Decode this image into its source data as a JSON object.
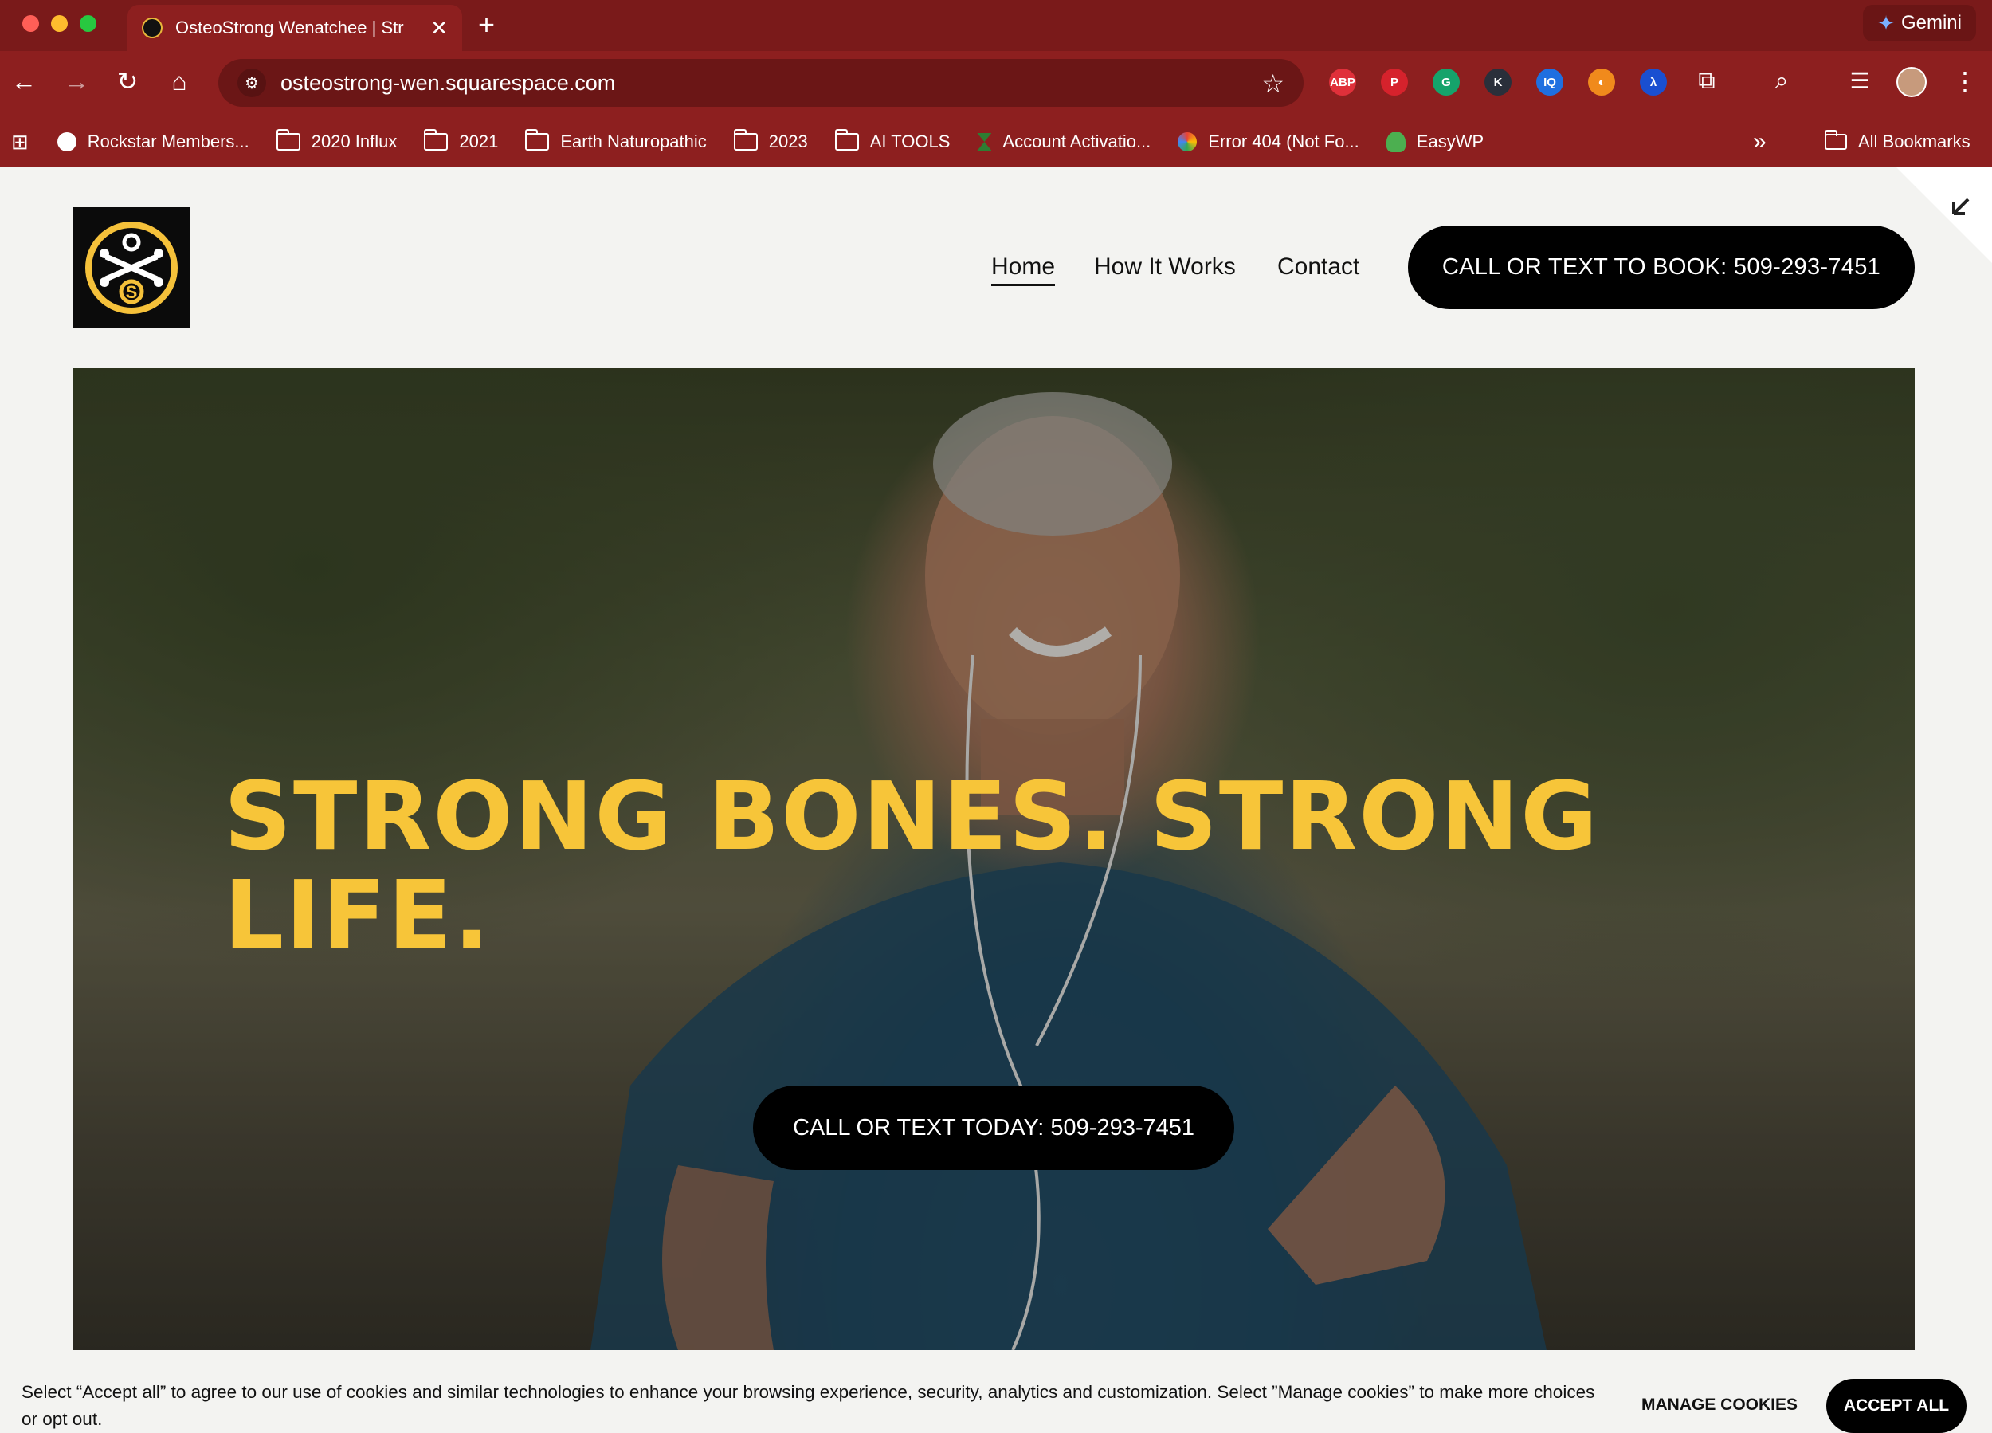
{
  "browser": {
    "tab_title": "OsteoStrong Wenatchee | Str",
    "tab_close": "✕",
    "new_tab": "+",
    "gemini_label": "Gemini",
    "url": "osteostrong-wen.squarespace.com",
    "nav_icons": [
      "back-icon",
      "forward-icon",
      "reload-icon",
      "home-icon"
    ],
    "extensions": [
      {
        "name": "adblock-plus-icon",
        "label": "ABP",
        "color": "#e0303a"
      },
      {
        "name": "pinterest-icon",
        "label": "P",
        "color": "#d6222c"
      },
      {
        "name": "grammarly-icon",
        "label": "G",
        "color": "#15a36b"
      },
      {
        "name": "k-extension-icon",
        "label": "K",
        "color": "#2a2f3a"
      },
      {
        "name": "iq-extension-icon",
        "label": "IQ",
        "color": "#1f6fe0"
      },
      {
        "name": "orange-extension-icon",
        "label": "◐",
        "color": "#f08a1c"
      },
      {
        "name": "lambda-extension-icon",
        "label": "λ",
        "color": "#1a4fd1"
      }
    ]
  },
  "bookmarks": {
    "items": [
      {
        "label": "Rockstar Members...",
        "icon": "globe-icon"
      },
      {
        "label": "2020 Influx",
        "icon": "folder-icon"
      },
      {
        "label": "2021",
        "icon": "folder-icon"
      },
      {
        "label": "Earth Naturopathic",
        "icon": "folder-icon"
      },
      {
        "label": "2023",
        "icon": "folder-icon"
      },
      {
        "label": "AI TOOLS",
        "icon": "folder-icon"
      },
      {
        "label": "Account Activatio...",
        "icon": "hourglass-icon"
      },
      {
        "label": "Error 404 (Not Fo...",
        "icon": "pinwheel-icon"
      },
      {
        "label": "EasyWP",
        "icon": "octopus-icon"
      }
    ],
    "overflow": "»",
    "all_bookmarks": "All Bookmarks"
  },
  "site": {
    "nav": [
      {
        "label": "Home",
        "active": true
      },
      {
        "label": "How It Works",
        "active": false
      },
      {
        "label": "Contact",
        "active": false
      }
    ],
    "header_cta": "CALL OR TEXT TO BOOK: 509-293-7451",
    "logo_letter": "S"
  },
  "hero": {
    "title_line1": "STRONG BONES. STRONG",
    "title_line2": "LIFE.",
    "cta": "CALL OR TEXT TODAY: 509-293-7451"
  },
  "cookie_banner": {
    "text": "Select “Accept all” to agree to our use of cookies and similar technologies to enhance your browsing experience, security, analytics and customization. Select ”Manage cookies” to make more choices or opt out.",
    "manage_label": "MANAGE COOKIES",
    "accept_label": "ACCEPT ALL"
  },
  "colors": {
    "browser_frame": "#8d1f1f",
    "hero_title": "#f7c539",
    "button_bg": "#000000",
    "page_bg": "#f3f3f1"
  }
}
